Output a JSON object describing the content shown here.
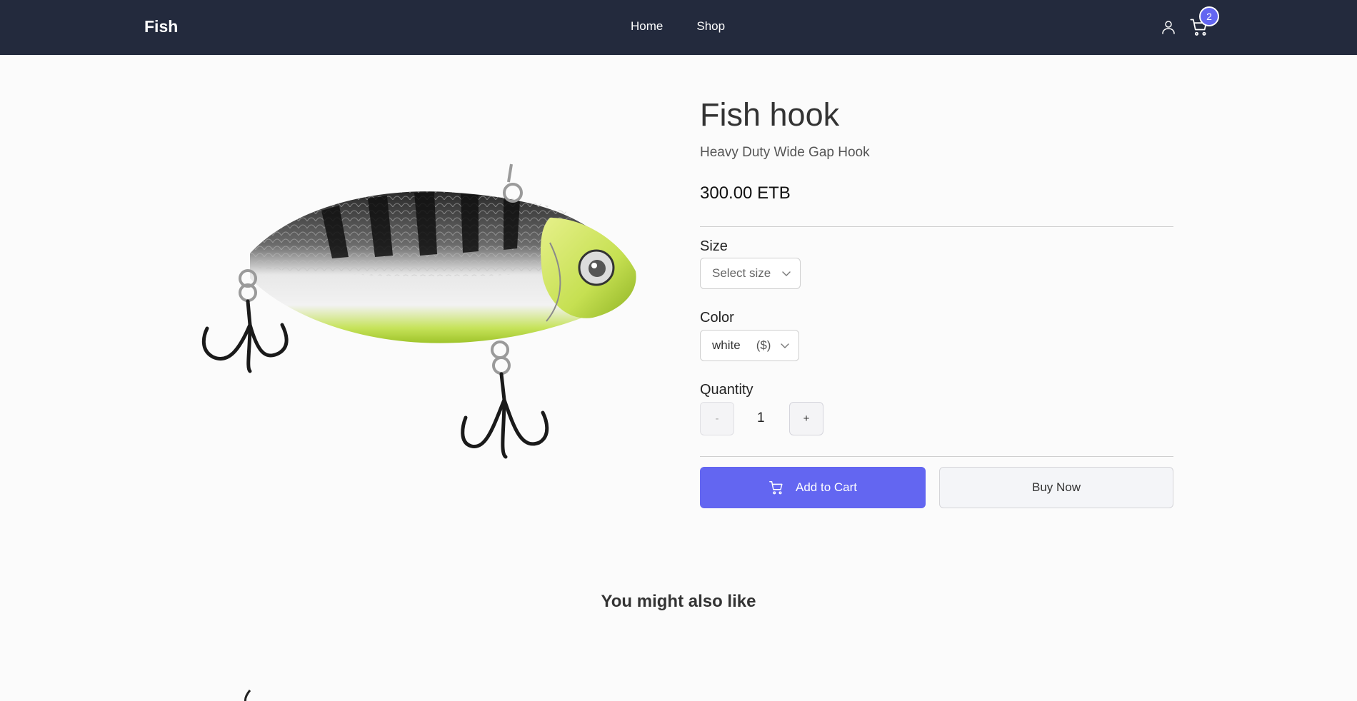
{
  "navbar": {
    "brand": "Fish",
    "links": [
      {
        "label": "Home"
      },
      {
        "label": "Shop"
      }
    ],
    "cart_count": "2",
    "icons": {
      "account": "user-icon",
      "cart": "cart-icon"
    }
  },
  "product": {
    "title": "Fish hook",
    "subtitle": "Heavy Duty Wide Gap Hook",
    "price": "300.00 ETB",
    "size": {
      "label": "Size",
      "selected": "Select size"
    },
    "color": {
      "label": "Color",
      "selected": "white",
      "price_note": "($)"
    },
    "quantity": {
      "label": "Quantity",
      "value": "1",
      "decrement": "-",
      "increment": "+"
    },
    "add_to_cart": "Add to Cart",
    "buy_now": "Buy Now"
  },
  "related": {
    "heading": "You might also like"
  },
  "colors": {
    "navbar_bg": "#232a3d",
    "accent": "#6366f1",
    "page_bg": "#fbfbfb"
  }
}
